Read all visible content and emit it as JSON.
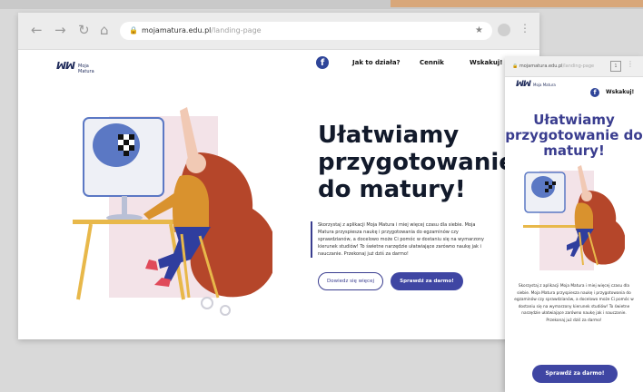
{
  "desktop": {
    "browser": {
      "back_icon": "←",
      "forward_icon": "→",
      "reload_icon": "↻",
      "home_icon": "⌂",
      "url_host": "mojamatura.edu.pl",
      "url_path": "/landing-page",
      "star_icon": "★",
      "menu_icon": "⋮"
    },
    "logo": {
      "mark": "ꟽꟽ",
      "text": "Moja Matura"
    },
    "nav": {
      "facebook_icon": "f",
      "how_it_works": "Jak to działa?",
      "pricing": "Cennik",
      "contact": "Wskakuj!"
    },
    "hero": {
      "title": "Ułatwiamy przygotowanie do matury!",
      "description": "Skorzystaj z aplikacji Moja Matura i miej więcej czasu dla siebie. Moja Matura przyspiesza naukę i przygotowania do egzaminów czy sprawdzianów, a docelowo może Ci pomóc w dostaniu się na wymarzony kierunek studiów! To świetne narzędzie ułatwiające zarówno naukę jak i nauczanie. Przekonaj już dziś za darmo!",
      "secondary_button": "Dowiedz się więcej",
      "primary_button": "Sprawdź za darmo!"
    }
  },
  "mobile": {
    "browser": {
      "url_host": "mojamatura.edu.pl",
      "url_path": "/landing-page",
      "tabs_count": "1",
      "menu_icon": "⋮"
    },
    "logo": {
      "mark": "ꟽꟽ",
      "text": "Moja Matura"
    },
    "facebook_icon": "f",
    "contact": "Wskakuj!",
    "title": "Ułatwiamy przygotowanie do matury!",
    "description": "Skorzystaj z aplikacji Moja Matura i miej więcej czasu dla siebie. Moja Matura przyspiesza naukę i przygotowania do egzaminów czy sprawdzianów, a docelowo może Ci pomóc w dostaniu się na wymarzony kierunek studiów! To świetne narzędzie ułatwiające zarówno naukę jak i nauczanie. Przekonaj już dziś za darmo!",
    "button": "Sprawdź za darmo!"
  },
  "colors": {
    "brand_navy": "#3a3d8f",
    "button_fill": "#3f46a3",
    "title_dark": "#121a2b",
    "hair": "#b5462a",
    "sweater": "#d9922e",
    "monitor_blue": "#5b78c4",
    "chair_yellow": "#e8b84a"
  }
}
